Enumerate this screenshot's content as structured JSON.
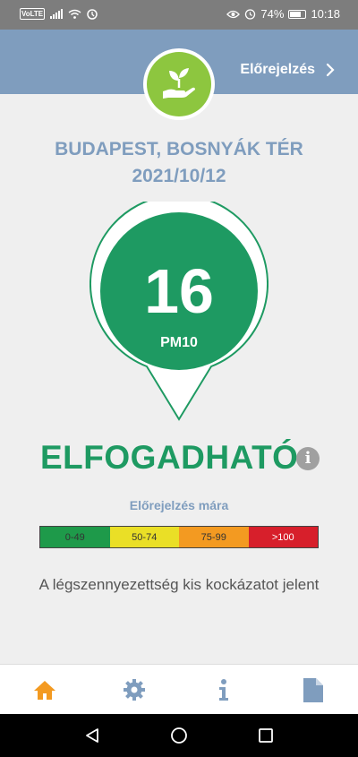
{
  "status_bar": {
    "volte": "VoLTE",
    "battery_text": "74%",
    "battery_level": 0.74,
    "time": "10:18"
  },
  "header": {
    "forecast_link": "Előrejelzés",
    "logo_icon": "plant-in-hand-icon"
  },
  "station": {
    "name": "BUDAPEST, BOSNYÁK TÉR",
    "date": "2021/10/12"
  },
  "reading": {
    "value": "16",
    "pollutant": "PM10",
    "color": "#1e9a62"
  },
  "status": {
    "label": "ELFOGADHATÓ",
    "info_icon": "info-icon"
  },
  "forecast": {
    "label": "Előrejelzés mára",
    "scale": [
      {
        "range": "0-49",
        "color": "#1e9a4a"
      },
      {
        "range": "50-74",
        "color": "#eadf26"
      },
      {
        "range": "75-99",
        "color": "#f39a21"
      },
      {
        "range": ">100",
        "color": "#d71f2b"
      }
    ]
  },
  "description": "A légszennyezettség kis kockázatot jelent",
  "tabs": [
    {
      "icon": "home-icon",
      "color": "#f39a21"
    },
    {
      "icon": "gear-icon",
      "color": "#7f9dbe"
    },
    {
      "icon": "info-icon",
      "color": "#7f9dbe"
    },
    {
      "icon": "document-icon",
      "color": "#7f9dbe"
    }
  ],
  "nav": [
    "back-icon",
    "home-circle-icon",
    "recents-icon"
  ]
}
